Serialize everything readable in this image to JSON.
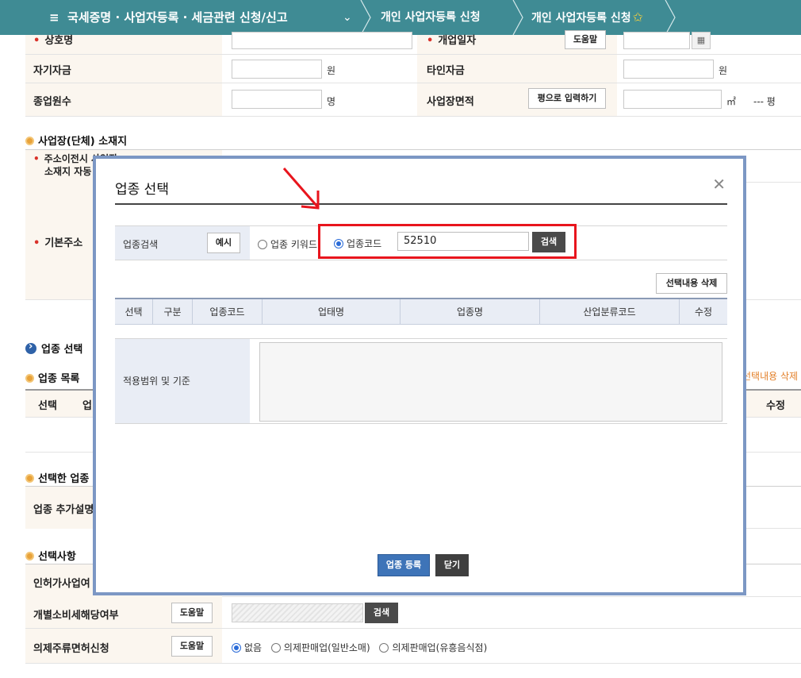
{
  "nav": {
    "menu_label": "국세증명 · 사업자등록 · 세금관련 신청/신고",
    "crumb1": "개인 사업자등록 신청",
    "crumb2": "개인 사업자등록 신청"
  },
  "form": {
    "trade_name": "상호명",
    "open_date": "개업일자",
    "help": "도움말",
    "own_capital": "자기자금",
    "won": "원",
    "other_capital": "타인자금",
    "employees": "종업원수",
    "people_unit": "명",
    "area": "사업장면적",
    "pyeong_input_btn": "평으로 입력하기",
    "sqm": "㎡",
    "pyeong_value": "--- 평",
    "location_section": "사업장(단체) 소재지",
    "address_change_label1": "주소이전시 사업장",
    "address_change_label2": "소재지 자동",
    "base_address": "기본주소",
    "industry_select_section": "업종 선택",
    "industry_list_section": "업종 목록",
    "col_select": "선택",
    "col_partial": "업",
    "col_edit": "수정",
    "delete_selected_partial": "선택내용 삭제",
    "selected_industry_section": "선택한 업종",
    "industry_extra_desc": "업종 추가설명",
    "options_section": "선택사항",
    "license_business": "인허가사업여",
    "excise_tax": "개별소비세해당여부",
    "search": "검색",
    "liquor_license": "의제주류면허신청",
    "liquor_opt_none": "없음",
    "liquor_opt_retail": "의제판매업(일반소매)",
    "liquor_opt_bar": "의제판매업(유흥음식점)"
  },
  "modal": {
    "title": "업종 선택",
    "search_label": "업종검색",
    "example_btn": "예시",
    "opt_keyword": "업종 키워드",
    "opt_code": "업종코드",
    "code_value": "52510",
    "search_btn": "검색",
    "delete_selected_btn": "선택내용 삭제",
    "columns": [
      "선택",
      "구분",
      "업종코드",
      "업태명",
      "업종명",
      "산업분류코드",
      "수정"
    ],
    "scope_label": "적용범위 및 기준",
    "register_btn": "업종 등록",
    "close_btn": "닫기"
  },
  "colors": {
    "nav_bg": "#3f8b94",
    "modal_border": "#7c97c4",
    "highlight": "#e8151d",
    "required": "#d9322a",
    "primary_button": "#3e74b8"
  }
}
